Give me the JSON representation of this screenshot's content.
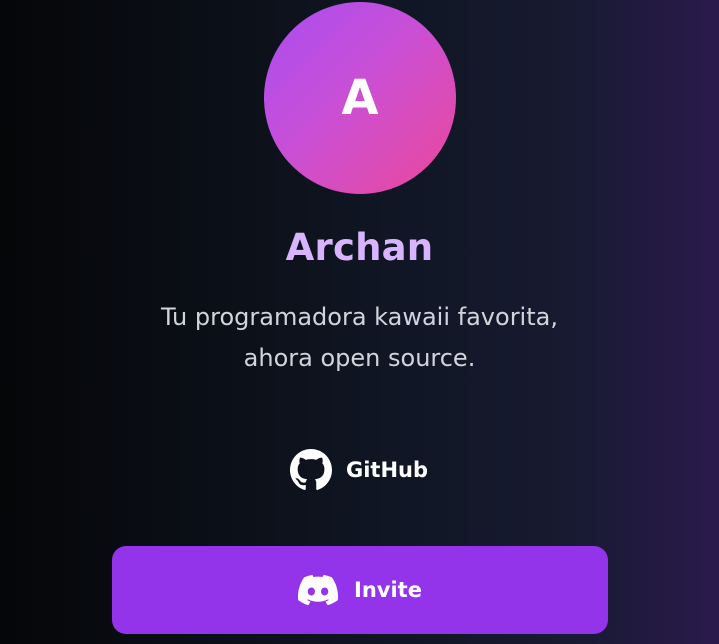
{
  "profile": {
    "avatar_initial": "A",
    "name": "Archan",
    "tagline_line1": "Tu programadora kawaii favorita,",
    "tagline_line2": "ahora open source."
  },
  "links": {
    "github": {
      "label": "GitHub",
      "icon": "github-icon"
    },
    "invite": {
      "label": "Invite",
      "icon": "discord-icon"
    }
  },
  "colors": {
    "name": "#d8b4fe",
    "button": "#9333ea",
    "avatar_start": "#a94ef2",
    "avatar_end": "#ec4899"
  }
}
